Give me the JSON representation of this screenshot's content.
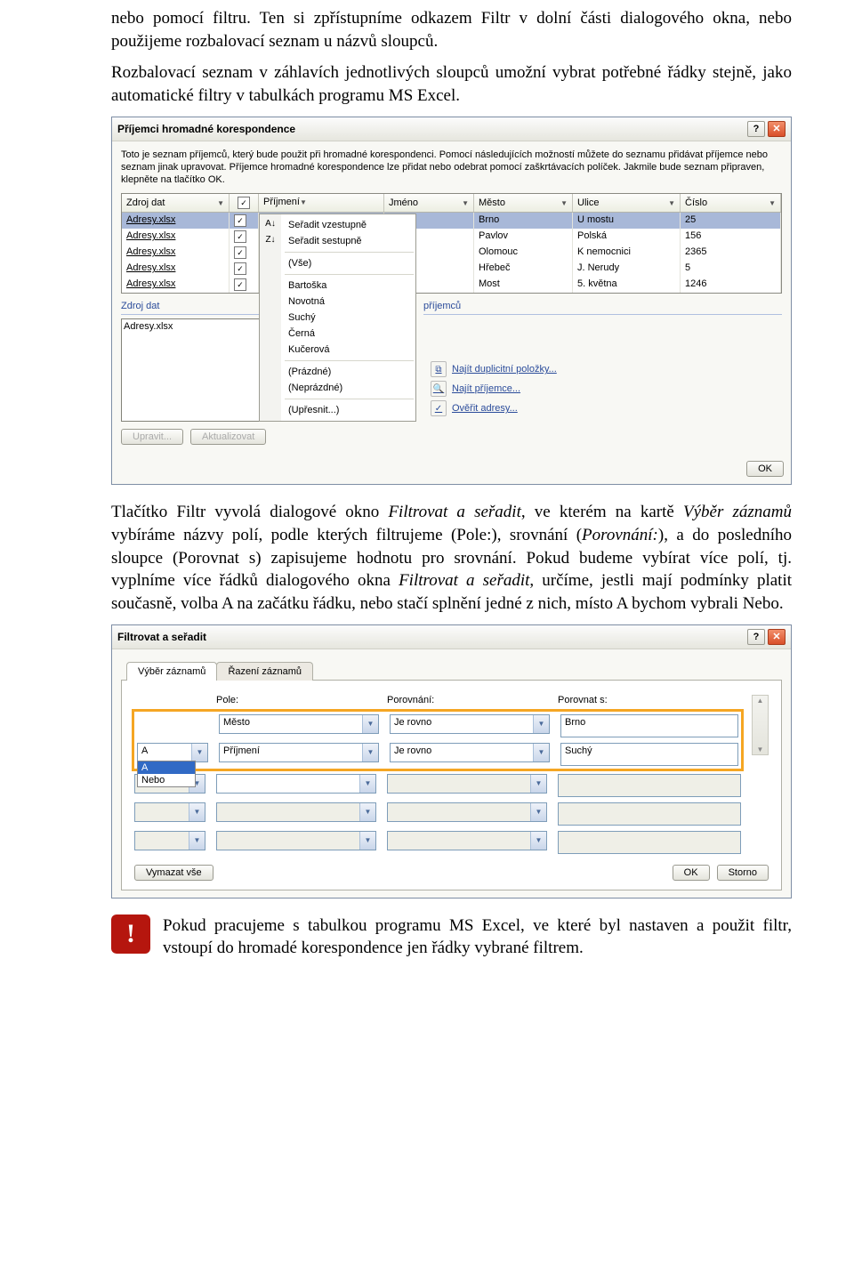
{
  "intro_p1": "nebo pomocí filtru. Ten si zpřístupníme odkazem Filtr v dolní části dialogového okna, nebo použijeme rozbalovací seznam u názvů sloupců.",
  "intro_p2": "Rozbalovací seznam v záhlavích jednotlivých sloupců umožní vybrat potřebné řádky stejně, jako automatické filtry v tabulkách programu MS Excel.",
  "dlg1": {
    "title": "Příjemci hromadné korespondence",
    "desc": "Toto je seznam příjemců, který bude použit při hromadné korespondenci. Pomocí následujících možností můžete do seznamu přidávat příjemce nebo seznam jinak upravovat. Příjemce hromadné korespondence lze přidat nebo odebrat pomocí zaškrtávacích políček. Jakmile bude seznam připraven, klepněte na tlačítko OK.",
    "cols": {
      "src": "Zdroj dat",
      "surname": "Příjmení",
      "name": "Jméno",
      "city": "Město",
      "street": "Ulice",
      "num": "Číslo"
    },
    "rows": [
      {
        "src": "Adresy.xlsx",
        "city": "Brno",
        "street": "U mostu",
        "num": "25",
        "sel": true
      },
      {
        "src": "Adresy.xlsx",
        "city": "Pavlov",
        "street": "Polská",
        "num": "156"
      },
      {
        "src": "Adresy.xlsx",
        "city": "Olomouc",
        "street": "K nemocnici",
        "num": "2365"
      },
      {
        "src": "Adresy.xlsx",
        "city": "Hřebeč",
        "street": "J. Nerudy",
        "num": "5"
      },
      {
        "src": "Adresy.xlsx",
        "city": "Most",
        "street": "5. května",
        "num": "1246"
      }
    ],
    "menu": {
      "sort_asc": "Seřadit vzestupně",
      "sort_desc": "Seřadit sestupně",
      "all": "(Vše)",
      "items": [
        "Bartoška",
        "Novotná",
        "Suchý",
        "Černá",
        "Kučerová"
      ],
      "blank": "(Prázdné)",
      "nonblank": "(Neprázdné)",
      "advanced": "(Upřesnit...)"
    },
    "lower_label": "Zdroj dat",
    "lower_label2": "příjemců",
    "list_item": "Adresy.xlsx",
    "links": {
      "dupl": "Najít duplicitní položky...",
      "find": "Najít příjemce...",
      "verify": "Ověřit adresy..."
    },
    "btn_edit": "Upravit...",
    "btn_refresh": "Aktualizovat",
    "btn_ok": "OK"
  },
  "mid_p": {
    "a": "Tlačítko Filtr vyvolá dialogové okno ",
    "b": "Filtrovat a seřadit",
    "c": ", ve kterém na kartě ",
    "d": "Výběr záznamů",
    "e": " vybíráme názvy polí, podle kterých filtrujeme (Pole:), srovnání (",
    "f": "Porovnání:",
    "g": "), a do posledního sloupce (Porovnat s) zapisujeme hodnotu pro srovnání. Pokud budeme vybírat více polí, tj. vyplníme více řádků dialogového okna ",
    "h": "Filtrovat a seřadit",
    "i": ", určíme, jestli mají podmínky platit současně, volba A na začátku řádku, nebo stačí splnění jedné z nich, místo A bychom vybrali Nebo."
  },
  "dlg2": {
    "title": "Filtrovat a seřadit",
    "tab1": "Výběr záznamů",
    "tab2": "Řazení záznamů",
    "lbl_pole": "Pole:",
    "lbl_comp": "Porovnání:",
    "lbl_with": "Porovnat s:",
    "and": "A",
    "and_list": [
      "A",
      "Nebo"
    ],
    "r1": {
      "pole": "Město",
      "comp": "Je rovno",
      "with": "Brno"
    },
    "r2": {
      "pole": "Příjmení",
      "comp": "Je rovno",
      "with": "Suchý"
    },
    "btn_clear": "Vymazat vše",
    "btn_ok": "OK",
    "btn_cancel": "Storno"
  },
  "note": "Pokud pracujeme s tabulkou programu MS Excel, ve které byl nastaven a použit filtr, vstoupí do hromadé korespondence jen řádky vybrané filtrem."
}
